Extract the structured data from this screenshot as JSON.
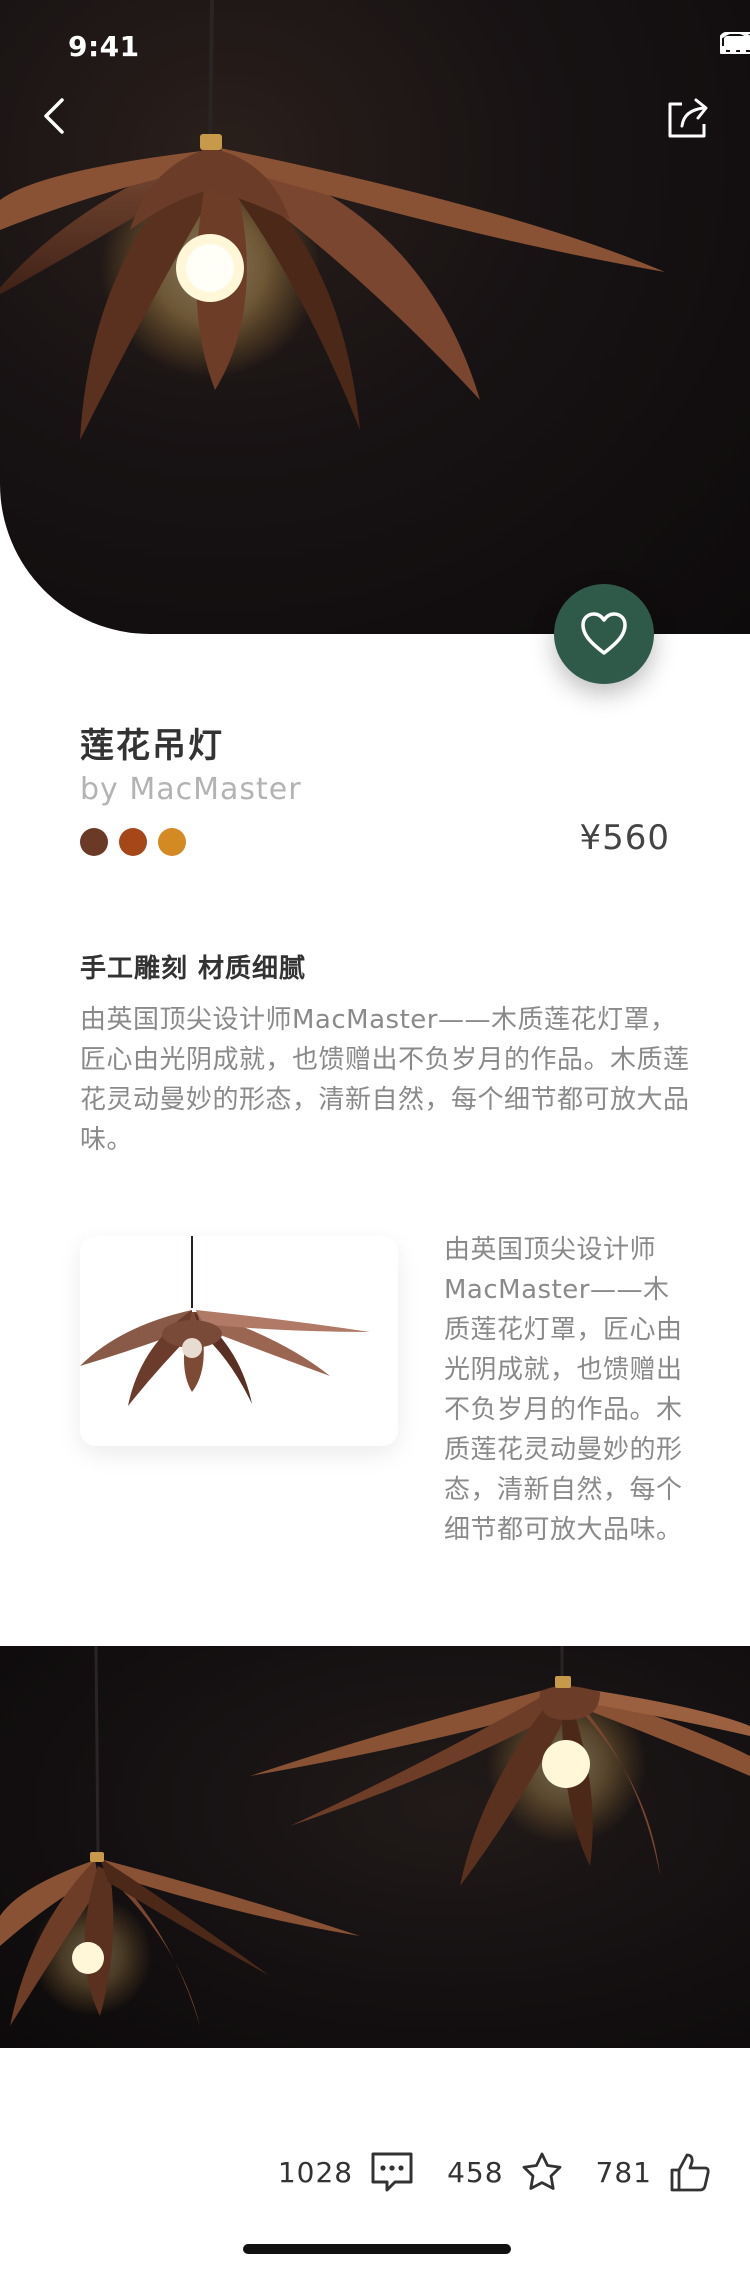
{
  "status_bar": {
    "time": "9:41"
  },
  "product": {
    "title": "莲花吊灯",
    "designer": "by MacMaster",
    "price": "¥560",
    "colors": [
      "#6b3a26",
      "#a6471a",
      "#d48a22"
    ]
  },
  "section": {
    "heading": "手工雕刻 材质细腻",
    "body": "由英国顶尖设计师MacMaster——木质莲花灯罩，匠心由光阴成就，也馈赠出不负岁月的作品。木质莲花灵动曼妙的形态，清新自然，每个细节都可放大品味。"
  },
  "side_text": "由英国顶尖设计师MacMaster——木质莲花灯罩，匠心由光阴成就，也馈赠出不负岁月的作品。木质莲花灵动曼妙的形态，清新自然，每个细节都可放大品味。",
  "actions": {
    "comments": "1028",
    "favorites": "458",
    "likes": "781"
  },
  "icons": {
    "back": "chevron-left-icon",
    "share": "share-icon",
    "favorite": "heart-icon",
    "comment": "comment-icon",
    "star": "star-icon",
    "like": "thumbs-up-icon"
  },
  "theme": {
    "accent": "#2f5a4a"
  }
}
